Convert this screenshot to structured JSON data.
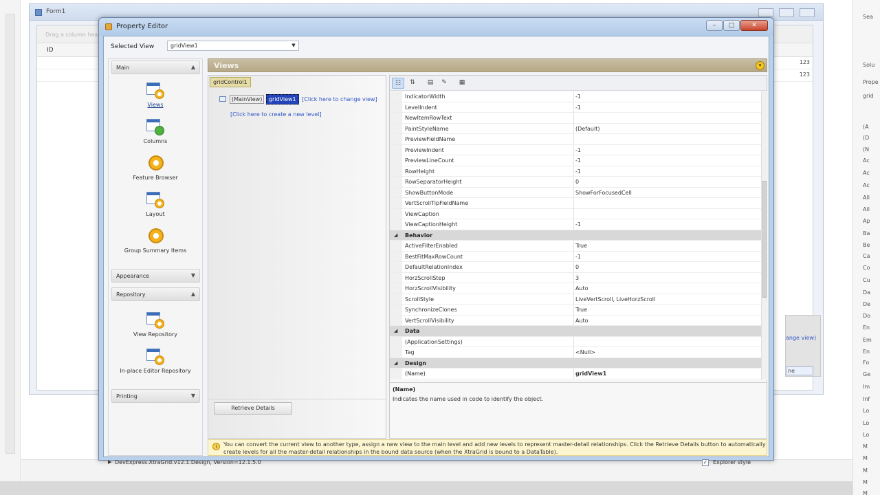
{
  "background": {
    "form_title": "Form1",
    "group_panel_hint": "Drag a column header here to group by that column",
    "grid_header": "ID",
    "grid_rows": [
      "123",
      "123"
    ],
    "peek_link": "ange view)",
    "peek_button": "ne"
  },
  "right_pane": {
    "items": [
      "Sea",
      "Solu",
      "Prope",
      "grid",
      "(A",
      "(D",
      "(N",
      "Ac",
      "Ac",
      "Ac",
      "All",
      "All",
      "Ap",
      "Ba",
      "Be",
      "Ca",
      "Co",
      "Cu",
      "Da",
      "De",
      "Do",
      "En",
      "Em",
      "En",
      "Fo",
      "Ge",
      "Im",
      "Inf",
      "Lo",
      "Lo",
      "Lo",
      "M",
      "M",
      "M",
      "M",
      "M"
    ]
  },
  "dialog": {
    "title": "Property Editor",
    "controls": {
      "minimize": "–",
      "maximize": "□",
      "close": "✕"
    },
    "selected_view_label": "Selected View",
    "selected_view_value": "gridView1",
    "nav": {
      "main_group": "Main",
      "items": {
        "views": "Views",
        "columns": "Columns",
        "feature_browser": "Feature Browser",
        "layout": "Layout",
        "group_summary": "Group Summary Items"
      },
      "appearance_group": "Appearance",
      "repository_group": "Repository",
      "repo_items": {
        "view_repository": "View Repository",
        "inplace_editor_repository": "In-place Editor Repository"
      },
      "printing_group": "Printing"
    },
    "views_header": "Views",
    "tree": {
      "root": "gridControl1",
      "main_view": "(MainView)",
      "view_name": "gridView1",
      "change_view_link": "[Click here to change view]",
      "new_level_link": "[Click here to create a new level]",
      "retrieve_button": "Retrieve Details"
    },
    "property_grid": {
      "rows": [
        {
          "name": "IndicatorWidth",
          "value": "-1"
        },
        {
          "name": "LevelIndent",
          "value": "-1"
        },
        {
          "name": "NewItemRowText",
          "value": ""
        },
        {
          "name": "PaintStyleName",
          "value": "(Default)"
        },
        {
          "name": "PreviewFieldName",
          "value": ""
        },
        {
          "name": "PreviewIndent",
          "value": "-1"
        },
        {
          "name": "PreviewLineCount",
          "value": "-1"
        },
        {
          "name": "RowHeight",
          "value": "-1"
        },
        {
          "name": "RowSeparatorHeight",
          "value": "0"
        },
        {
          "name": "ShowButtonMode",
          "value": "ShowForFocusedCell"
        },
        {
          "name": "VertScrollTipFieldName",
          "value": ""
        },
        {
          "name": "ViewCaption",
          "value": ""
        },
        {
          "name": "ViewCaptionHeight",
          "value": "-1"
        },
        {
          "name": "Behavior",
          "value": "",
          "category": true
        },
        {
          "name": "ActiveFilterEnabled",
          "value": "True"
        },
        {
          "name": "BestFitMaxRowCount",
          "value": "-1"
        },
        {
          "name": "DefaultRelationIndex",
          "value": "0"
        },
        {
          "name": "HorzScrollStep",
          "value": "3"
        },
        {
          "name": "HorzScrollVisibility",
          "value": "Auto"
        },
        {
          "name": "ScrollStyle",
          "value": "LiveVertScroll, LiveHorzScroll"
        },
        {
          "name": "SynchronizeClones",
          "value": "True"
        },
        {
          "name": "VertScrollVisibility",
          "value": "Auto"
        },
        {
          "name": "Data",
          "value": "",
          "category": true
        },
        {
          "name": "(ApplicationSettings)",
          "value": ""
        },
        {
          "name": "Tag",
          "value": "<Null>"
        },
        {
          "name": "Design",
          "value": "",
          "category": true
        },
        {
          "name": "(Name)",
          "value": "gridView1",
          "selected": true
        }
      ],
      "desc_name": "(Name)",
      "desc_text": "Indicates the name used in code to identify the object."
    },
    "hint": "You can convert the current view to another type, assign a new view to the main level and add new levels to represent master-detail relationships. Click the Retrieve Details button to automatically create levels for all the master-detail relationships in the bound data source (when the XtraGrid is bound to a DataTable).",
    "status": {
      "version": "DevExpress.XtraGrid.v12.1.Design, Version=12.1.5.0",
      "explorer_style": "Explorer style",
      "explorer_checked": true
    }
  }
}
